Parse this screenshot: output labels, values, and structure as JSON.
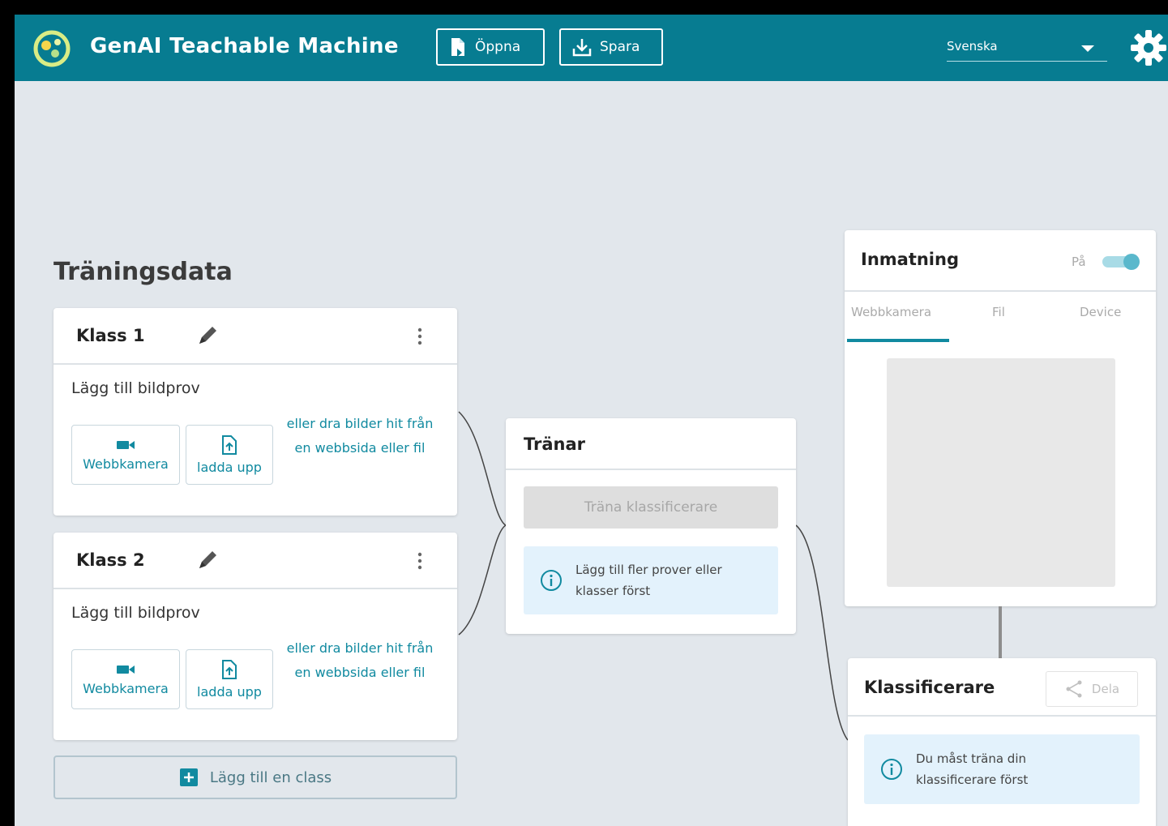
{
  "header": {
    "title": "GenAI Teachable Machine",
    "open_label": "Öppna",
    "save_label": "Spara",
    "language": "Svenska"
  },
  "training": {
    "title": "Träningsdata",
    "classes": [
      {
        "name": "Klass 1",
        "add_samples": "Lägg till bildprov",
        "webcam_label": "Webbkamera",
        "upload_label": "ladda upp",
        "drag_hint": "eller dra bilder hit från en webbsida eller fil"
      },
      {
        "name": "Klass 2",
        "add_samples": "Lägg till bildprov",
        "webcam_label": "Webbkamera",
        "upload_label": "ladda upp",
        "drag_hint": "eller dra bilder hit från en webbsida eller fil"
      }
    ],
    "add_class_label": "Lägg till en class"
  },
  "trainer": {
    "title": "Tränar",
    "train_button": "Träna klassificerare",
    "info": "Lägg till fler prover eller klasser först"
  },
  "input": {
    "title": "Inmatning",
    "toggle_label": "På",
    "toggle_on": true,
    "tabs": [
      "Webbkamera",
      "Fil",
      "Device"
    ],
    "active_tab": "Webbkamera"
  },
  "classifier": {
    "title": "Klassificerare",
    "share_label": "Dela",
    "info": "Du måst träna din klassificerare först"
  },
  "colors": {
    "header": "#077c91",
    "accent": "#118aa0",
    "background": "#e2e7ec",
    "info_bg": "#e3f2fc"
  }
}
